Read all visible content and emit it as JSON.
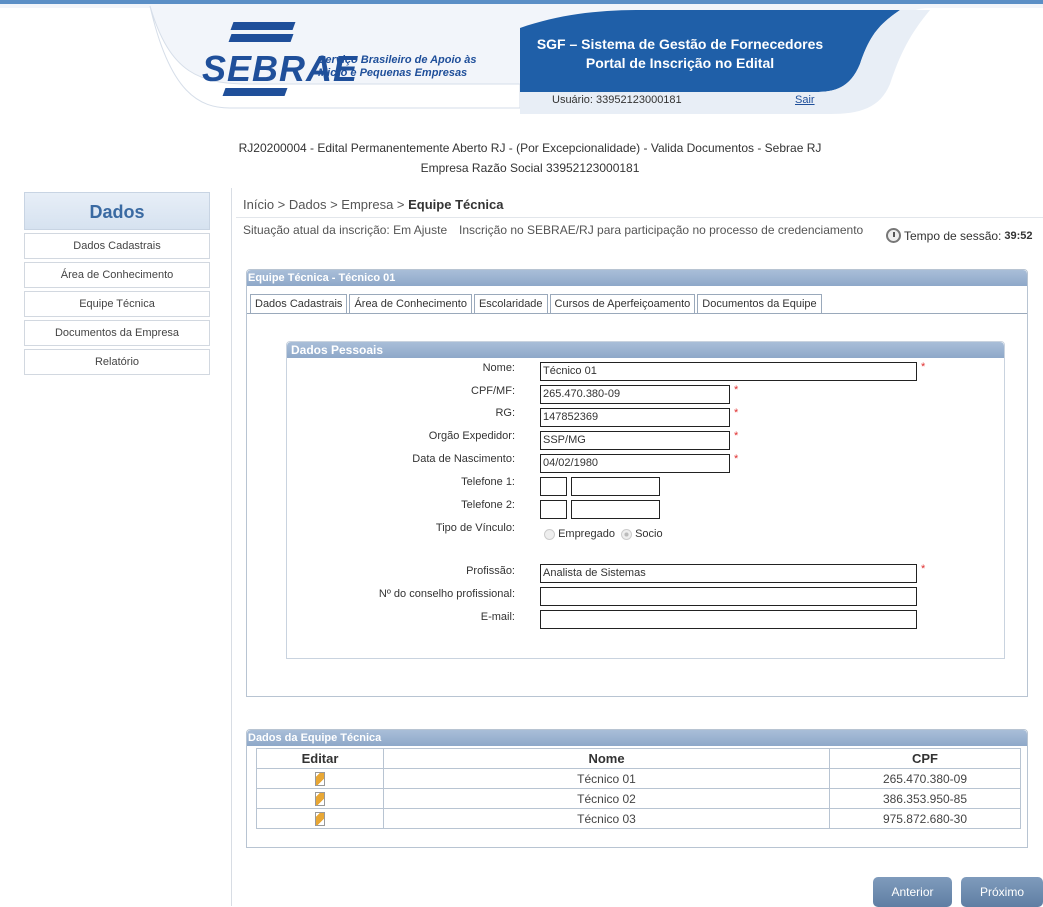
{
  "header": {
    "logo_text": "SEBRAE",
    "logo_sub1": "Serviço Brasileiro de Apoio às",
    "logo_sub2": "Micro e Pequenas Empresas",
    "system_title1": "SGF – Sistema de Gestão de Fornecedores",
    "system_title2": "Portal de Inscrição no Edital",
    "user_label": "Usuário: 33952123000181",
    "logout_label": "Sair",
    "brand_color": "#1f4f9a"
  },
  "edital": {
    "line1": "RJ20200004 - Edital Permanentemente Aberto RJ - (Por Excepcionalidade) - Valida Documentos - Sebrae RJ",
    "line2": "Empresa Razão Social 33952123000181"
  },
  "sidebar": {
    "title": "Dados",
    "items": [
      {
        "label": "Dados Cadastrais"
      },
      {
        "label": "Área de Conhecimento"
      },
      {
        "label": "Equipe Técnica"
      },
      {
        "label": "Documentos da Empresa"
      },
      {
        "label": "Relatório"
      }
    ]
  },
  "breadcrumb": {
    "path": "Início > Dados > Empresa > ",
    "current": "Equipe Técnica"
  },
  "status": {
    "situation": "Situação atual da inscrição: Em Ajuste",
    "inscription": "Inscrição no SEBRAE/RJ para participação no processo de credenciamento",
    "session_label": "Tempo de sessão:",
    "session_value": "39:52"
  },
  "panel": {
    "title": "Equipe Técnica - Técnico 01",
    "tabs": [
      {
        "label": "Dados Cadastrais"
      },
      {
        "label": "Área de Conhecimento"
      },
      {
        "label": "Escolaridade"
      },
      {
        "label": "Cursos de Aperfeiçoamento"
      },
      {
        "label": "Documentos da Equipe"
      }
    ],
    "section_title": "Dados Pessoais",
    "fields": {
      "nome": {
        "label": "Nome:",
        "value": "Técnico 01"
      },
      "cpf": {
        "label": "CPF/MF:",
        "value": "265.470.380-09"
      },
      "rg": {
        "label": "RG:",
        "value": "147852369"
      },
      "orgao": {
        "label": "Orgão Expedidor:",
        "value": "SSP/MG"
      },
      "nascimento": {
        "label": "Data de Nascimento:",
        "value": "04/02/1980"
      },
      "telefone1": {
        "label": "Telefone 1:",
        "ddd": "",
        "value": ""
      },
      "telefone2": {
        "label": "Telefone 2:",
        "ddd": "",
        "value": ""
      },
      "vinculo": {
        "label": "Tipo de Vínculo:",
        "options": [
          "Empregado",
          "Socio"
        ],
        "selected": "Socio"
      },
      "profissao": {
        "label": "Profissão:",
        "value": "Analista de Sistemas"
      },
      "conselho": {
        "label": "Nº do conselho profissional:",
        "value": ""
      },
      "email": {
        "label": "E-mail:",
        "value": ""
      }
    },
    "required_mark": "*"
  },
  "team_list": {
    "title": "Dados da Equipe Técnica",
    "columns": [
      "Editar",
      "Nome",
      "CPF"
    ],
    "rows": [
      {
        "name": "Técnico 01",
        "cpf": "265.470.380-09"
      },
      {
        "name": "Técnico 02",
        "cpf": "386.353.950-85"
      },
      {
        "name": "Técnico 03",
        "cpf": "975.872.680-30"
      }
    ]
  },
  "buttons": {
    "prev": "Anterior",
    "next": "Próximo"
  }
}
